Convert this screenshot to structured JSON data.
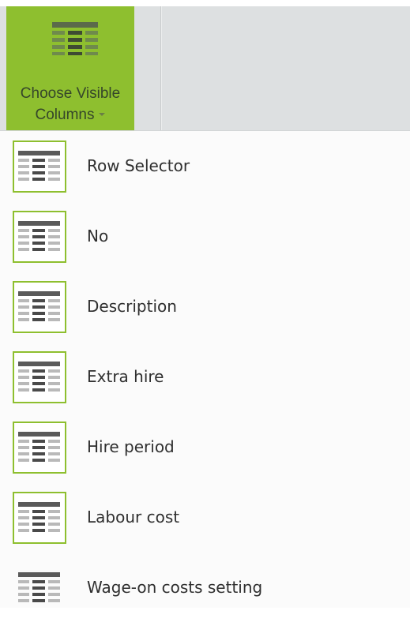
{
  "ribbon": {
    "button": {
      "label_line1": "Choose Visible",
      "label_line2": "Columns",
      "icon": "table-columns-icon"
    }
  },
  "menu": {
    "items": [
      {
        "label": "Row Selector",
        "checked": true,
        "icon": "table-columns-icon"
      },
      {
        "label": "No",
        "checked": true,
        "icon": "table-columns-icon"
      },
      {
        "label": "Description",
        "checked": true,
        "icon": "table-columns-icon"
      },
      {
        "label": "Extra hire",
        "checked": true,
        "icon": "table-columns-icon"
      },
      {
        "label": "Hire period",
        "checked": true,
        "icon": "table-columns-icon"
      },
      {
        "label": "Labour cost",
        "checked": true,
        "icon": "table-columns-icon"
      },
      {
        "label": "Wage-on costs setting",
        "checked": false,
        "icon": "table-columns-icon"
      }
    ]
  },
  "colors": {
    "accent": "#8ebf2f",
    "ribbon_bg": "#dde0e1",
    "menu_bg": "#fbfbfb",
    "icon_dark": "#4a4a4a",
    "icon_light": "#b5b5b5"
  }
}
